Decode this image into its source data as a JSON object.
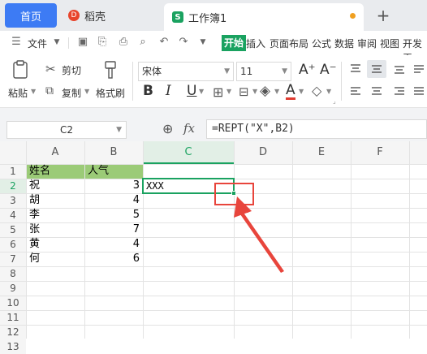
{
  "tabs": {
    "home": "首页",
    "docer": "稻壳",
    "docer_logo": "D",
    "workbook": "工作簿1",
    "workbook_logo": "S",
    "new_tab": "+"
  },
  "menu": {
    "file": "文件",
    "start": "开始",
    "insert": "插入",
    "layout": "页面布局",
    "formula": "公式",
    "data": "数据",
    "review": "审阅",
    "view": "视图",
    "dev": "开发工"
  },
  "ribbon": {
    "paste": "粘贴",
    "cut": "剪切",
    "copy": "复制",
    "format_painter": "格式刷",
    "font_name": "宋体",
    "font_size": "11",
    "bold": "B",
    "italic": "I",
    "underline": "U",
    "grow": "A⁺",
    "shrink": "A⁻",
    "font_color": "A",
    "fill_color": "A"
  },
  "formula_bar": {
    "cell_ref": "C2",
    "fx": "fx",
    "formula": "=REPT(\"X\",B2)"
  },
  "sheet": {
    "columns": [
      "A",
      "B",
      "C",
      "D",
      "E",
      "F"
    ],
    "rows": [
      "1",
      "2",
      "3",
      "4",
      "5",
      "6",
      "7",
      "8",
      "9",
      "10",
      "11",
      "12",
      "13"
    ],
    "header_a": "姓名",
    "header_b": "人气",
    "names": [
      "祝",
      "胡",
      "李",
      "张",
      "黄",
      "何"
    ],
    "values": [
      "3",
      "4",
      "5",
      "7",
      "4",
      "6"
    ],
    "c2_result": "XXX"
  },
  "colors": {
    "accent_green": "#1aa260",
    "home_tab_blue": "#3d7bf4",
    "header_fill": "#9bcb77",
    "annotation_red": "#e8453c"
  }
}
